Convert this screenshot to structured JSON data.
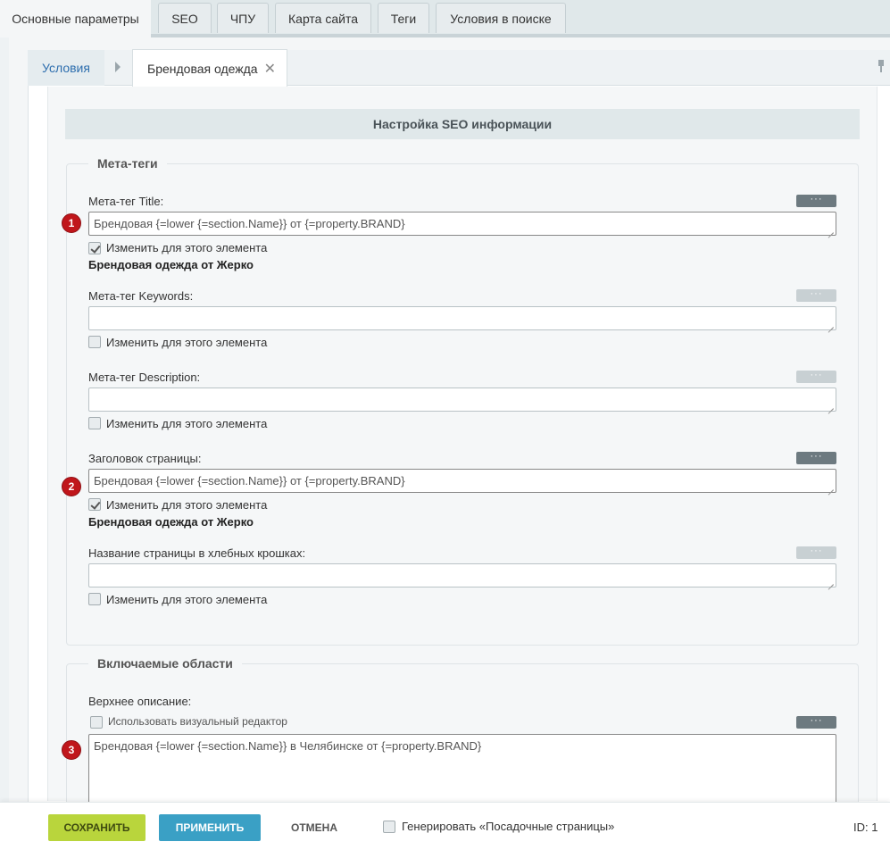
{
  "top_tabs": [
    {
      "label": "Основные параметры",
      "active": true
    },
    {
      "label": "SEO"
    },
    {
      "label": "ЧПУ"
    },
    {
      "label": "Карта сайта"
    },
    {
      "label": "Теги"
    },
    {
      "label": "Условия в поиске"
    }
  ],
  "inner_tabs": {
    "conditions": "Условия",
    "active": "Брендовая одежда"
  },
  "seo_header": "Настройка SEO информации",
  "meta": {
    "legend": "Мета-теги",
    "title_label": "Мета-тег Title:",
    "title_value": "Брендовая {=lower {=section.Name}} от {=property.BRAND}",
    "title_check": "Изменить для этого элемента",
    "title_preview": "Брендовая одежда от Жерко",
    "keywords_label": "Мета-тег Keywords:",
    "keywords_value": "",
    "keywords_check": "Изменить для этого элемента",
    "description_label": "Мета-тег Description:",
    "description_value": "",
    "description_check": "Изменить для этого элемента",
    "heading_label": "Заголовок страницы:",
    "heading_value": "Брендовая {=lower {=section.Name}} от {=property.BRAND}",
    "heading_check": "Изменить для этого элемента",
    "heading_preview": "Брендовая одежда от Жерко",
    "breadcrumb_label": "Название страницы в хлебных крошках:",
    "breadcrumb_value": "",
    "breadcrumb_check": "Изменить для этого элемента",
    "dots": "···"
  },
  "includes": {
    "legend": "Включаемые области",
    "top_desc_label": "Верхнее описание:",
    "visual_editor": "Использовать визуальный редактор",
    "top_desc_value": "Брендовая {=lower {=section.Name}} в Челябинске  от {=property.BRAND}"
  },
  "badges": [
    "1",
    "2",
    "3"
  ],
  "bottom": {
    "save": "Сохранить",
    "apply": "Применить",
    "cancel": "Отмена",
    "generate": "Генерировать «Посадочные страницы»",
    "id": "ID: 1"
  },
  "colors": {
    "save": "#b9d53c",
    "apply": "#3aa0c5",
    "badge": "#c0161b",
    "link": "#2d6eae"
  }
}
